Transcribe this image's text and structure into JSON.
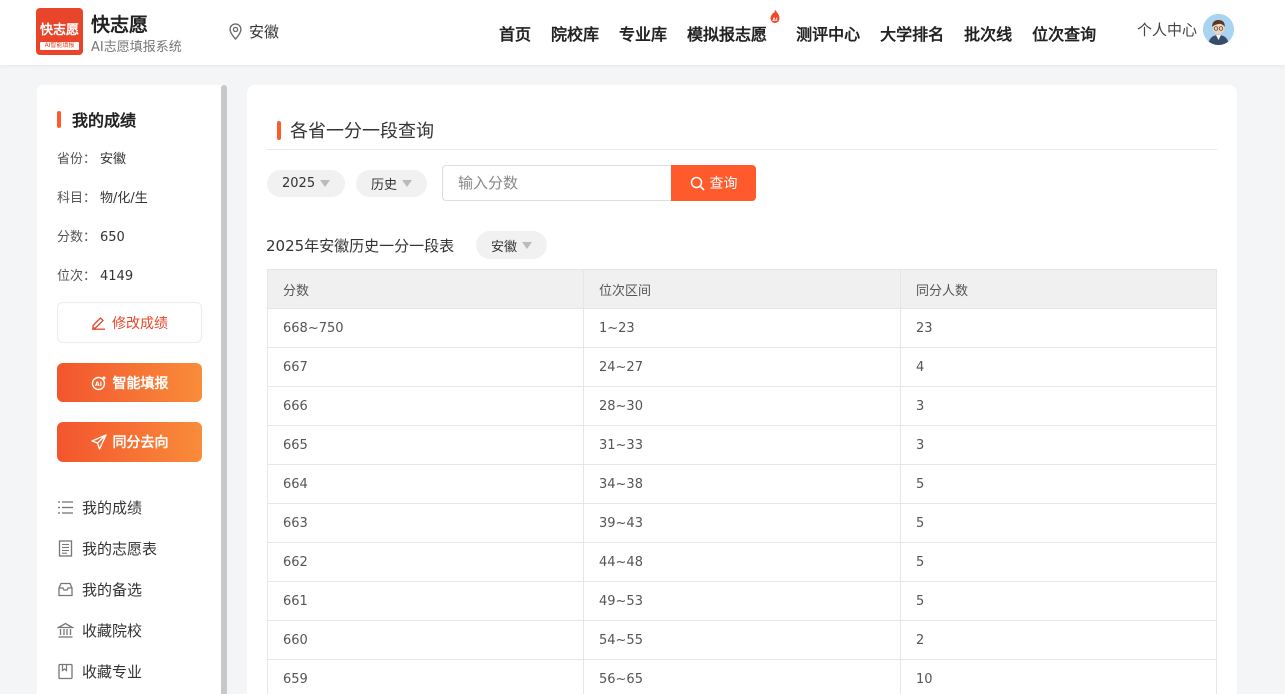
{
  "header": {
    "logo_text": "快志愿",
    "logo_sub": "AI智能填报",
    "brand_name": "快志愿",
    "brand_sub": "AI志愿填报系统",
    "location": "安徽",
    "nav": [
      "首页",
      "院校库",
      "专业库",
      "模拟报志愿",
      "测评中心",
      "大学排名",
      "批次线",
      "位次查询"
    ],
    "user_center": "个人中心"
  },
  "sidebar": {
    "title": "我的成绩",
    "fields": [
      {
        "label": "省份：",
        "value": "安徽"
      },
      {
        "label": "科目：",
        "value": "物/化/生"
      },
      {
        "label": "分数：",
        "value": "650"
      },
      {
        "label": "位次：",
        "value": "4149"
      }
    ],
    "edit_button": "修改成绩",
    "smart_button": "智能填报",
    "same_score_button": "同分去向",
    "menu": [
      "我的成绩",
      "我的志愿表",
      "我的备选",
      "收藏院校",
      "收藏专业"
    ]
  },
  "main": {
    "title": "各省一分一段查询",
    "year": "2025",
    "subject": "历史",
    "score_placeholder": "输入分数",
    "query_button": "查询",
    "table_title": "2025年安徽历史一分一段表",
    "province": "安徽",
    "columns": [
      "分数",
      "位次区间",
      "同分人数"
    ],
    "rows": [
      [
        "668~750",
        "1~23",
        "23"
      ],
      [
        "667",
        "24~27",
        "4"
      ],
      [
        "666",
        "28~30",
        "3"
      ],
      [
        "665",
        "31~33",
        "3"
      ],
      [
        "664",
        "34~38",
        "5"
      ],
      [
        "663",
        "39~43",
        "5"
      ],
      [
        "662",
        "44~48",
        "5"
      ],
      [
        "661",
        "49~53",
        "5"
      ],
      [
        "660",
        "54~55",
        "2"
      ],
      [
        "659",
        "56~65",
        "10"
      ]
    ]
  },
  "colors": {
    "accent": "#ff5a2c",
    "logo": "#e8452a"
  }
}
